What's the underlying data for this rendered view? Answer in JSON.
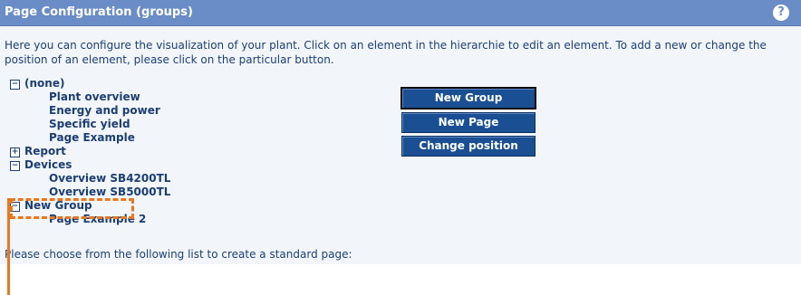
{
  "header": {
    "title": "Page Configuration (groups)",
    "help_icon": "?"
  },
  "intro_text": "Here you can configure the visualization of your plant. Click on an element in the hierarchie to edit an element. To add a new or change the position of an element, please click on the particular button.",
  "tree": {
    "none": {
      "label": "(none)",
      "toggle": "−"
    },
    "none_children": [
      "Plant overview",
      "Energy and power",
      "Specific yield",
      "Page Example"
    ],
    "report": {
      "label": "Report",
      "toggle": "+"
    },
    "devices": {
      "label": "Devices",
      "toggle": "−"
    },
    "devices_children": [
      "Overview SB4200TL",
      "Overview SB5000TL"
    ],
    "new_group": {
      "label": "New Group",
      "toggle": "−"
    },
    "new_group_children": [
      "Page Example 2"
    ]
  },
  "buttons": {
    "new_group": "New Group",
    "new_page": "New Page",
    "change_position": "Change position"
  },
  "choose_text": "Please choose from the following list to create a standard page:",
  "colors": {
    "header_bg": "#6a8cc7",
    "button_bg": "#1a4f93",
    "text": "#1c3e73",
    "highlight": "#e67822"
  }
}
